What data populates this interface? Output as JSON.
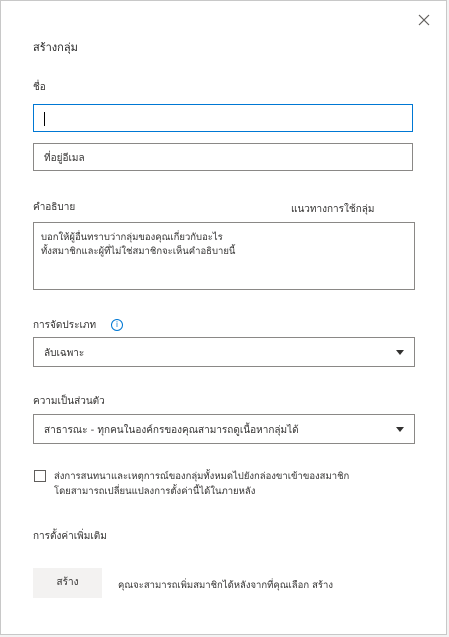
{
  "dialog": {
    "title": "สร้างกลุ่ม",
    "close_icon": "close-icon"
  },
  "name_field": {
    "label": "ชื่อ",
    "value": ""
  },
  "email_field": {
    "value": "ที่อยู่อีเมล"
  },
  "description": {
    "label": "คำอธิบาย",
    "guidelines_link": "แนวทางการใช้กลุ่ม",
    "line1": "บอกให้ผู้อื่นทราบว่ากลุ่มของคุณเกี่ยวกับอะไร",
    "line2": "ทั้งสมาชิกและผู้ที่ไม่ใช่สมาชิกจะเห็นคำอธิบายนี้"
  },
  "classification": {
    "label": "การจัดประเภท",
    "info_icon": "info-icon",
    "selected": "ลับเฉพาะ"
  },
  "privacy": {
    "label": "ความเป็นส่วนตัว",
    "selected": "สาธารณะ - ทุกคนในองค์กรของคุณสามารถดูเนื้อหากลุ่มได้"
  },
  "subscribe": {
    "checked": false,
    "line1": "ส่งการสนทนาและเหตุการณ์ของกลุ่มทั้งหมดไปยังกล่องขาเข้าของสมาชิก",
    "line2": "โดยสามารถเปลี่ยนแปลงการตั้งค่านี้ได้ในภายหลัง"
  },
  "more_settings": {
    "label": "การตั้งค่าเพิ่มเติม"
  },
  "footer": {
    "create_label": "สร้าง",
    "helper_text": "คุณจะสามารถเพิ่มสมาชิกได้หลังจากที่คุณเลือก สร้าง"
  },
  "colors": {
    "accent": "#0078d4",
    "border": "#8a8886",
    "button_bg": "#f3f2f1"
  }
}
